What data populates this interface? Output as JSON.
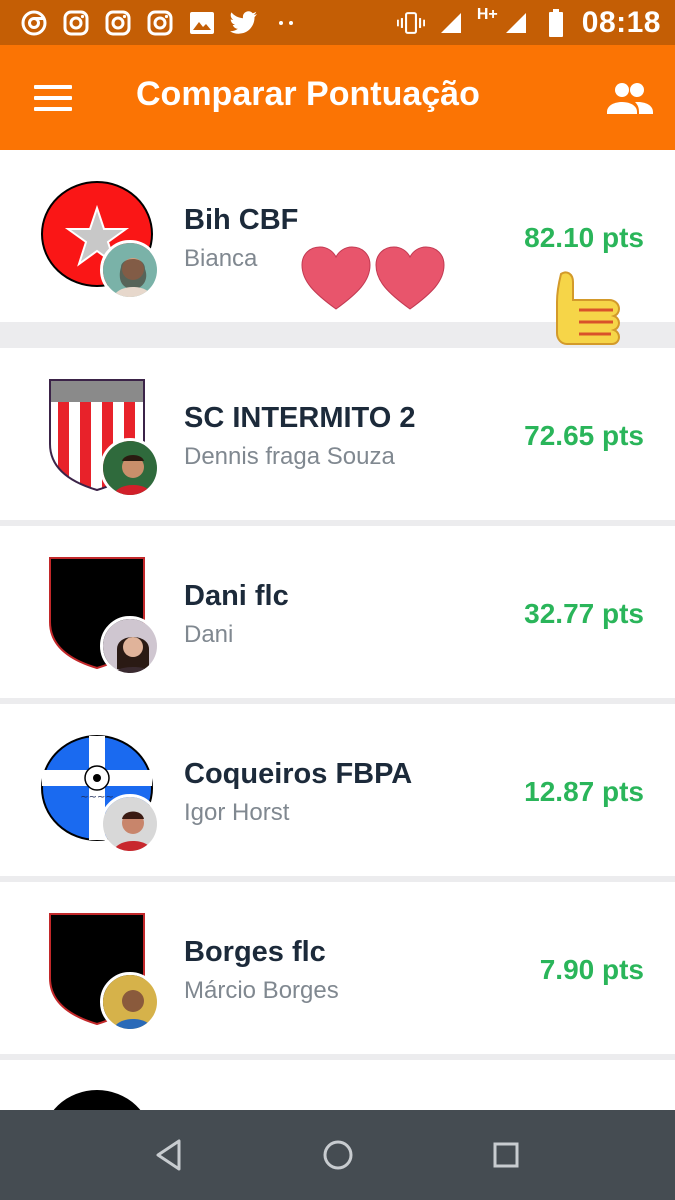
{
  "status_bar": {
    "time": "08:18",
    "network": "H+",
    "icons": [
      "chrome-icon",
      "instagram-icon",
      "instagram-icon",
      "instagram-icon",
      "image-icon",
      "twitter-icon",
      "dots-icon",
      "vibrate-icon",
      "signal-icon",
      "signal-icon",
      "battery-icon"
    ]
  },
  "app_bar": {
    "title": "Comparar Pontuação",
    "menu_icon": "hamburger-menu-icon",
    "people_icon": "people-icon"
  },
  "teams": [
    {
      "name": "Bih CBF",
      "owner": "Bianca",
      "points": "82.10 pts",
      "crest": "star"
    },
    {
      "name": "SC INTERMITO 2",
      "owner": "Dennis fraga Souza",
      "points": "72.65 pts",
      "crest": "stripes"
    },
    {
      "name": "Dani flc",
      "owner": "Dani",
      "points": "32.77 pts",
      "crest": "black"
    },
    {
      "name": "Coqueiros FBPA",
      "owner": "Igor Horst",
      "points": "12.87 pts",
      "crest": "blue"
    },
    {
      "name": "Borges flc",
      "owner": "Márcio Borges",
      "points": "7.90 pts",
      "crest": "black"
    }
  ],
  "colors": {
    "app_bar": "#fb7404",
    "status_bar": "#c45e05",
    "points": "#2ab55a",
    "team_name": "#1c2a3a",
    "owner": "#808890",
    "nav_bar": "#454c52"
  }
}
